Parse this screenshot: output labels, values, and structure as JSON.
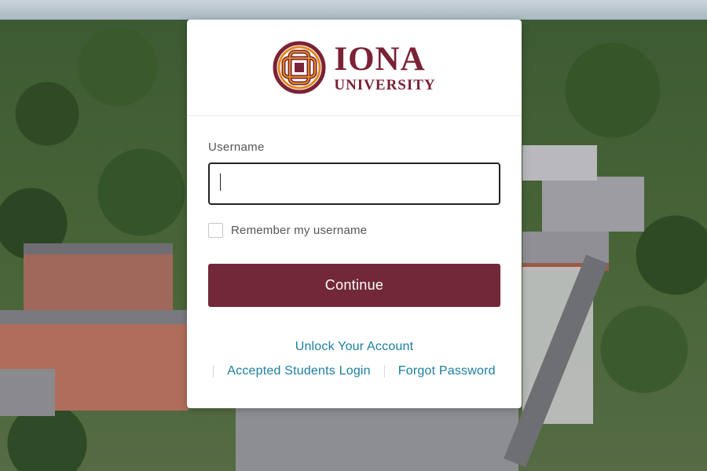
{
  "background": {
    "description_icon": "campus-aerial-photo"
  },
  "logo": {
    "icon": "celtic-knot-emblem-icon",
    "line1": "IONA",
    "line2": "UNIVERSITY",
    "brand_color": "#7a2236",
    "accent_color": "#e08a1e"
  },
  "form": {
    "username_label": "Username",
    "username_value": "",
    "remember_label": "Remember my username",
    "remember_checked": false,
    "continue_label": "Continue",
    "button_color": "#722838"
  },
  "links": {
    "unlock": "Unlock Your Account",
    "accepted": "Accepted Students Login",
    "forgot": "Forgot Password",
    "link_color": "#1b7ea0"
  }
}
